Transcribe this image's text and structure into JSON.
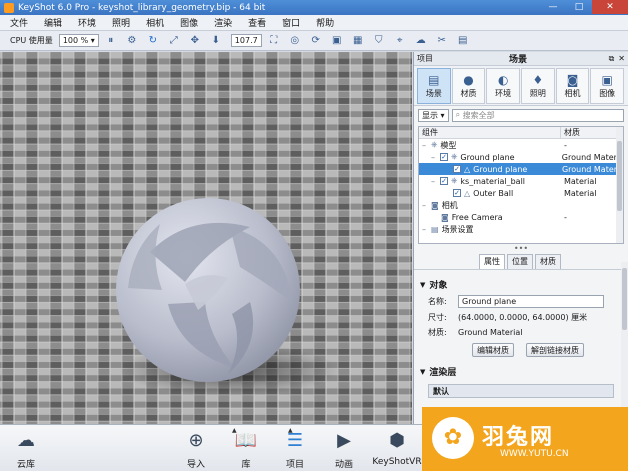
{
  "window": {
    "title": "KeyShot 6.0 Pro  - keyshot_library_geometry.bip  - 64 bit",
    "minimize": "—",
    "maximize": "□",
    "close": "✕"
  },
  "menu": [
    "文件",
    "编辑",
    "环境",
    "照明",
    "相机",
    "图像",
    "渲染",
    "查看",
    "窗口",
    "帮助"
  ],
  "toolbar": {
    "cpu_label": "CPU 使用量",
    "cpu_value": "100 %",
    "zoom_value": "107.7",
    "icons": [
      "pause-icon",
      "refresh-icon",
      "expand-icon",
      "tumble-icon",
      "move-down-icon",
      "crop-icon",
      "camera-icon",
      "settings-icon",
      "image-icon",
      "shield-icon",
      "cursor-icon",
      "tools-icon"
    ]
  },
  "panel": {
    "header_left": "项目",
    "header_center": "场景",
    "tabs": [
      {
        "label": "场景",
        "icon": "scene-icon"
      },
      {
        "label": "材质",
        "icon": "material-icon"
      },
      {
        "label": "环境",
        "icon": "environment-icon"
      },
      {
        "label": "照明",
        "icon": "light-icon"
      },
      {
        "label": "相机",
        "icon": "camera-icon"
      },
      {
        "label": "图像",
        "icon": "image-icon"
      }
    ],
    "show_label": "显示",
    "search_placeholder": "搜索全部",
    "tree_header": {
      "col1": "组件",
      "col2": "材质"
    },
    "tree": [
      {
        "name": "模型",
        "material": "-"
      },
      {
        "name": "Ground plane",
        "material": "Ground Materia"
      },
      {
        "name": "Ground plane",
        "material": "Ground Materia"
      },
      {
        "name": "ks_material_ball",
        "material": "Material"
      },
      {
        "name": "Outer Ball",
        "material": "Material"
      },
      {
        "name": "相机",
        "material": ""
      },
      {
        "name": "Free Camera",
        "material": "-"
      },
      {
        "name": "场景设置",
        "material": ""
      }
    ],
    "dots": "•••",
    "subtabs": [
      "属性",
      "位置",
      "材质"
    ],
    "object_section": {
      "title": "对象",
      "name_label": "名称:",
      "name_value": "Ground plane",
      "size_label": "尺寸:",
      "size_value": "(64.0000, 0.0000, 64.0000) 厘米",
      "material_label": "材质:",
      "material_value": "Ground Material",
      "edit_button": "编辑材质",
      "unlink_button": "解剖链接材质"
    },
    "render_layer": {
      "title": "渲染层",
      "default_label": "默认"
    }
  },
  "bottombar": [
    {
      "label": "云库",
      "icon": "cloud-library-icon"
    },
    {
      "label": "导入",
      "icon": "import-icon"
    },
    {
      "label": "库",
      "icon": "library-icon"
    },
    {
      "label": "项目",
      "icon": "project-icon"
    },
    {
      "label": "动画",
      "icon": "animation-icon"
    },
    {
      "label": "KeyShotVR",
      "icon": "keyshotvr-icon"
    }
  ],
  "watermark": {
    "title": "羽兔网",
    "url": "WWW.YUTU.CN"
  },
  "colors": {
    "titlebar": "#3a74c2",
    "accent": "#2f7fd3",
    "selection": "#3b8ad8",
    "watermark": "#f3a51d"
  }
}
